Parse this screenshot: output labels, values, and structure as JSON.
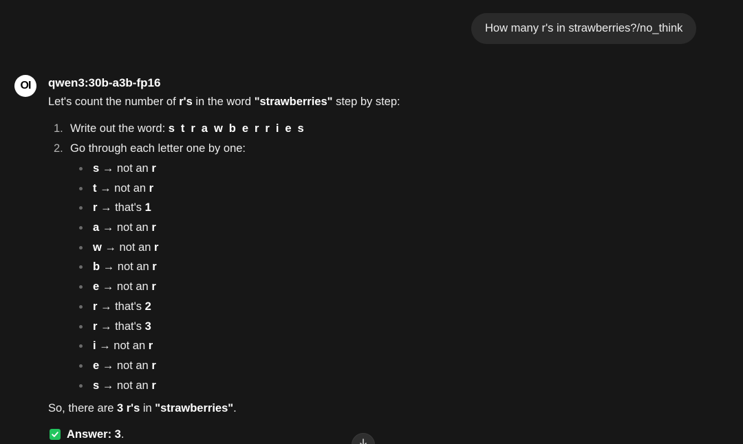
{
  "user_message": "How many r's in strawberries?/no_think",
  "assistant": {
    "avatar_text": "OI",
    "model_name": "qwen3:30b-a3b-fp16",
    "intro": {
      "a": "Let's count the number of ",
      "b": "r's",
      "c": " in the word ",
      "d": "\"strawberries\"",
      "e": " step by step:"
    },
    "steps": [
      {
        "num": "1.",
        "text": "Write out the word: ",
        "bold": "s t r a w b e r r i e s"
      },
      {
        "num": "2.",
        "text": "Go through each letter one by one:"
      }
    ],
    "letters": [
      {
        "letter": "s",
        "text": " → not an ",
        "result": "r"
      },
      {
        "letter": "t",
        "text": " → not an ",
        "result": "r"
      },
      {
        "letter": "r",
        "text": " → that's ",
        "result": "1"
      },
      {
        "letter": "a",
        "text": " → not an ",
        "result": "r"
      },
      {
        "letter": "w",
        "text": " → not an ",
        "result": "r"
      },
      {
        "letter": "b",
        "text": " → not an ",
        "result": "r"
      },
      {
        "letter": "e",
        "text": " → not an ",
        "result": "r"
      },
      {
        "letter": "r",
        "text": " → that's ",
        "result": "2"
      },
      {
        "letter": "r",
        "text": " → that's ",
        "result": "3"
      },
      {
        "letter": "i",
        "text": " → not an ",
        "result": "r"
      },
      {
        "letter": "e",
        "text": " → not an ",
        "result": "r"
      },
      {
        "letter": "s",
        "text": " → not an ",
        "result": "r"
      }
    ],
    "summary": {
      "a": "So, there are ",
      "b": "3 r's",
      "c": " in ",
      "d": "\"strawberries\"",
      "e": "."
    },
    "answer": {
      "label": "Answer: 3",
      "suffix": "."
    }
  },
  "icons": {
    "check": "check-icon",
    "scroll": "arrow-down-icon"
  },
  "colors": {
    "background": "#171717",
    "bubble": "#2a2a2a",
    "check": "#22c55e"
  }
}
